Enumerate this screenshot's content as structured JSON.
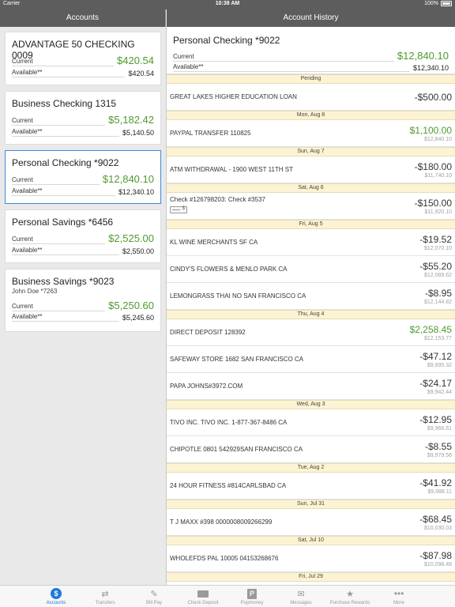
{
  "status_bar": {
    "carrier": "Carrier",
    "time": "10:38 AM",
    "battery": "100%"
  },
  "left_header": {
    "title": "Accounts"
  },
  "right_header": {
    "title": "Account History"
  },
  "labels": {
    "current": "Current",
    "available": "Available**"
  },
  "accounts": [
    {
      "name": "ADVANTAGE 50 CHECKING 0009",
      "sub": "",
      "current": "$420.54",
      "available": "$420.54"
    },
    {
      "name": "Business Checking 1315",
      "sub": "",
      "current": "$5,182.42",
      "available": "$5,140.50"
    },
    {
      "name": "Personal Checking *9022",
      "sub": "",
      "current": "$12,840.10",
      "available": "$12,340.10"
    },
    {
      "name": "Personal Savings *6456",
      "sub": "",
      "current": "$2,525.00",
      "available": "$2,550.00"
    },
    {
      "name": "Business Savings *9023",
      "sub": "John Doe *7263",
      "current": "$5,250.60",
      "available": "$5,245.60"
    }
  ],
  "selected_account": {
    "name": "Personal Checking *9022",
    "current": "$12,840.10",
    "available": "$12,340.10"
  },
  "history": {
    "pending": "Pending",
    "s1": "Mon, Aug 8",
    "s2": "Sun, Aug 7",
    "s3": "Sat, Aug 6",
    "s4": "Fri, Aug 5",
    "s5": "Thu, Aug 4",
    "s6": "Wed, Aug 3",
    "s7": "Tue, Aug 2",
    "s8": "Sun, Jul 31",
    "s9": "Sat, Jul 10",
    "s10": "Fri, Jul 29",
    "t0": {
      "desc": "GREAT LAKES HIGHER EDUCATION LOAN",
      "amount": "-$500.00",
      "balance": ""
    },
    "t1": {
      "desc": "PAYPAL TRANSFER 110825",
      "amount": "$1,100.00",
      "balance": "$12,840.10"
    },
    "t2": {
      "desc": "ATM WITHDRAWAL - 1900 WEST 11TH ST",
      "amount": "-$180.00",
      "balance": "$11,740.10"
    },
    "t3": {
      "desc": "Check #126798203: Check #3537",
      "amount": "-$150.00",
      "balance": "$11,920.10"
    },
    "t4": {
      "desc": "KL WINE MERCHANTS SF CA",
      "amount": "-$19.52",
      "balance": "$12,070.10"
    },
    "t5": {
      "desc": "CINDY'S FLOWERS & MENLO PARK CA",
      "amount": "-$55.20",
      "balance": "$12,089.62"
    },
    "t6": {
      "desc": "LEMONGRASS THAI NO SAN FRANCISCO CA",
      "amount": "-$8.95",
      "balance": "$12,144.82"
    },
    "t7": {
      "desc": "DIRECT DEPOSIT 128392",
      "amount": "$2,258.45",
      "balance": "$12,153.77"
    },
    "t8": {
      "desc": "SAFEWAY STORE 1682 SAN FRANCISCO CA",
      "amount": "-$47.12",
      "balance": "$9,895.32"
    },
    "t9": {
      "desc": "PAPA JOHNS#3972.COM",
      "amount": "-$24.17",
      "balance": "$9,942.44"
    },
    "t10": {
      "desc": "TIVO INC. TIVO INC. 1-877-367-8486 CA",
      "amount": "-$12.95",
      "balance": "$9,966.61"
    },
    "t11": {
      "desc": "CHIPOTLE 0801 542929SAN FRANCISCO CA",
      "amount": "-$8.55",
      "balance": "$9,979.56"
    },
    "t12": {
      "desc": "24 HOUR FITNESS #814CARLSBAD CA",
      "amount": "-$41.92",
      "balance": "$9,988.11"
    },
    "t13": {
      "desc": "T J MAXX #398 0000008009266299",
      "amount": "-$68.45",
      "balance": "$10,030.03"
    },
    "t14": {
      "desc": "WHOLEFDS PAL 10005 04153268676",
      "amount": "-$87.98",
      "balance": "$10,098.48"
    }
  },
  "tabs": [
    {
      "label": "Accounts",
      "icon": "dollar-icon"
    },
    {
      "label": "Transfers",
      "icon": "transfer-arrows-icon"
    },
    {
      "label": "Bill Pay",
      "icon": "bill-icon"
    },
    {
      "label": "Check Deposit",
      "icon": "check-icon"
    },
    {
      "label": "Popmoney",
      "icon": "popmoney-icon"
    },
    {
      "label": "Messages",
      "icon": "envelope-icon"
    },
    {
      "label": "Purchase Rewards",
      "icon": "star-icon"
    },
    {
      "label": "More",
      "icon": "more-dots-icon"
    }
  ],
  "colors": {
    "positive": "#4e9a2d",
    "accent": "#1f7ad8",
    "header": "#5d5d5d",
    "date_band": "#fcf3d2"
  }
}
